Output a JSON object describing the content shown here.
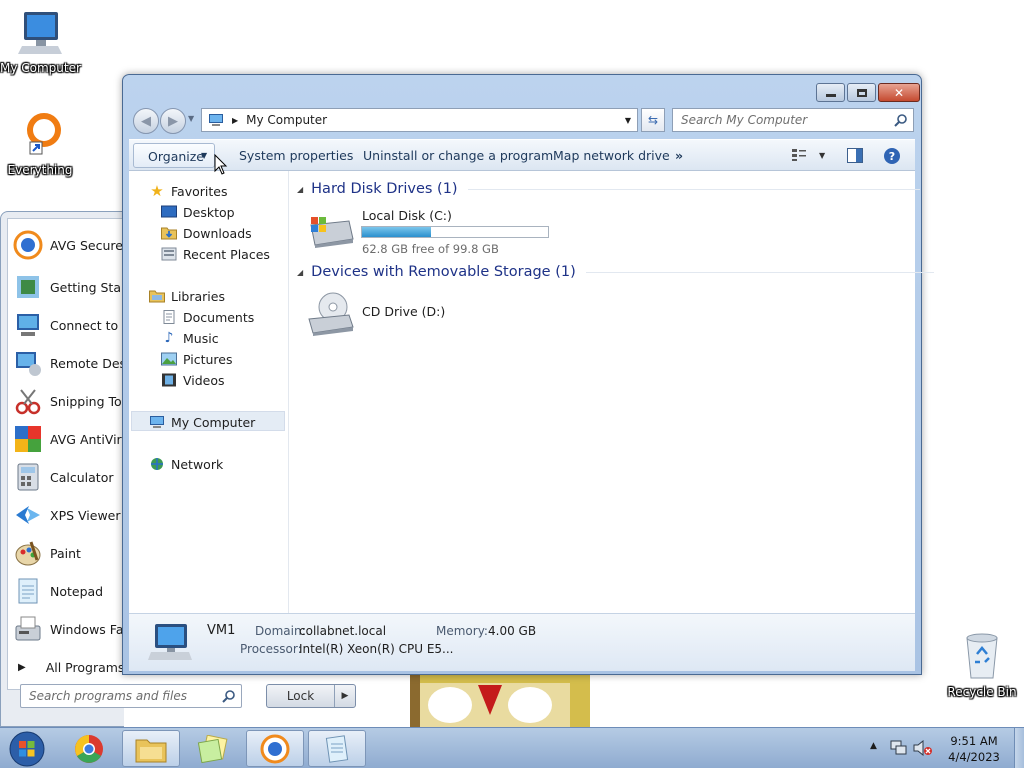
{
  "desktop": {
    "icons": [
      {
        "label": "My Computer"
      },
      {
        "label": "Everything"
      },
      {
        "label": "Recycle Bin"
      }
    ]
  },
  "start_menu": {
    "items": [
      {
        "label": "AVG Secure B"
      },
      {
        "label": "Getting Starte"
      },
      {
        "label": "Connect to a"
      },
      {
        "label": "Remote Deskt"
      },
      {
        "label": "Snipping Too"
      },
      {
        "label": "AVG AntiVirus"
      },
      {
        "label": "Calculator"
      },
      {
        "label": "XPS Viewer"
      },
      {
        "label": "Paint"
      },
      {
        "label": "Notepad"
      },
      {
        "label": "Windows Fax"
      }
    ],
    "all_programs": "All Programs",
    "search_placeholder": "Search programs and files",
    "lock_label": "Lock"
  },
  "explorer": {
    "address": "My Computer",
    "search_placeholder": "Search My Computer",
    "commands": {
      "organize": "Organize",
      "system_properties": "System properties",
      "uninstall": "Uninstall or change a program",
      "map_drive": "Map network drive",
      "more": "»"
    },
    "nav": {
      "favorites": "Favorites",
      "desktop": "Desktop",
      "downloads": "Downloads",
      "recent": "Recent Places",
      "libraries": "Libraries",
      "documents": "Documents",
      "music": "Music",
      "pictures": "Pictures",
      "videos": "Videos",
      "computer": "My Computer",
      "network": "Network"
    },
    "groups": {
      "hdd": "Hard Disk Drives (1)",
      "removable": "Devices with Removable Storage (1)"
    },
    "drives": {
      "c_name": "Local Disk (C:)",
      "c_free": "62.8 GB free of 99.8 GB",
      "c_used_fraction": 0.37,
      "d_name": "CD Drive (D:)"
    },
    "details": {
      "name": "VM1",
      "domain_label": "Domain:",
      "domain": "collabnet.local",
      "memory_label": "Memory:",
      "memory": "4.00 GB",
      "processor_label": "Processor:",
      "processor": "Intel(R) Xeon(R) CPU E5..."
    }
  },
  "taskbar": {
    "time": "9:51 AM",
    "date": "4/4/2023"
  },
  "colors": {
    "accent": "#3a86c8",
    "group_header": "#1e3287",
    "window_frame": "#a9c3e4"
  }
}
